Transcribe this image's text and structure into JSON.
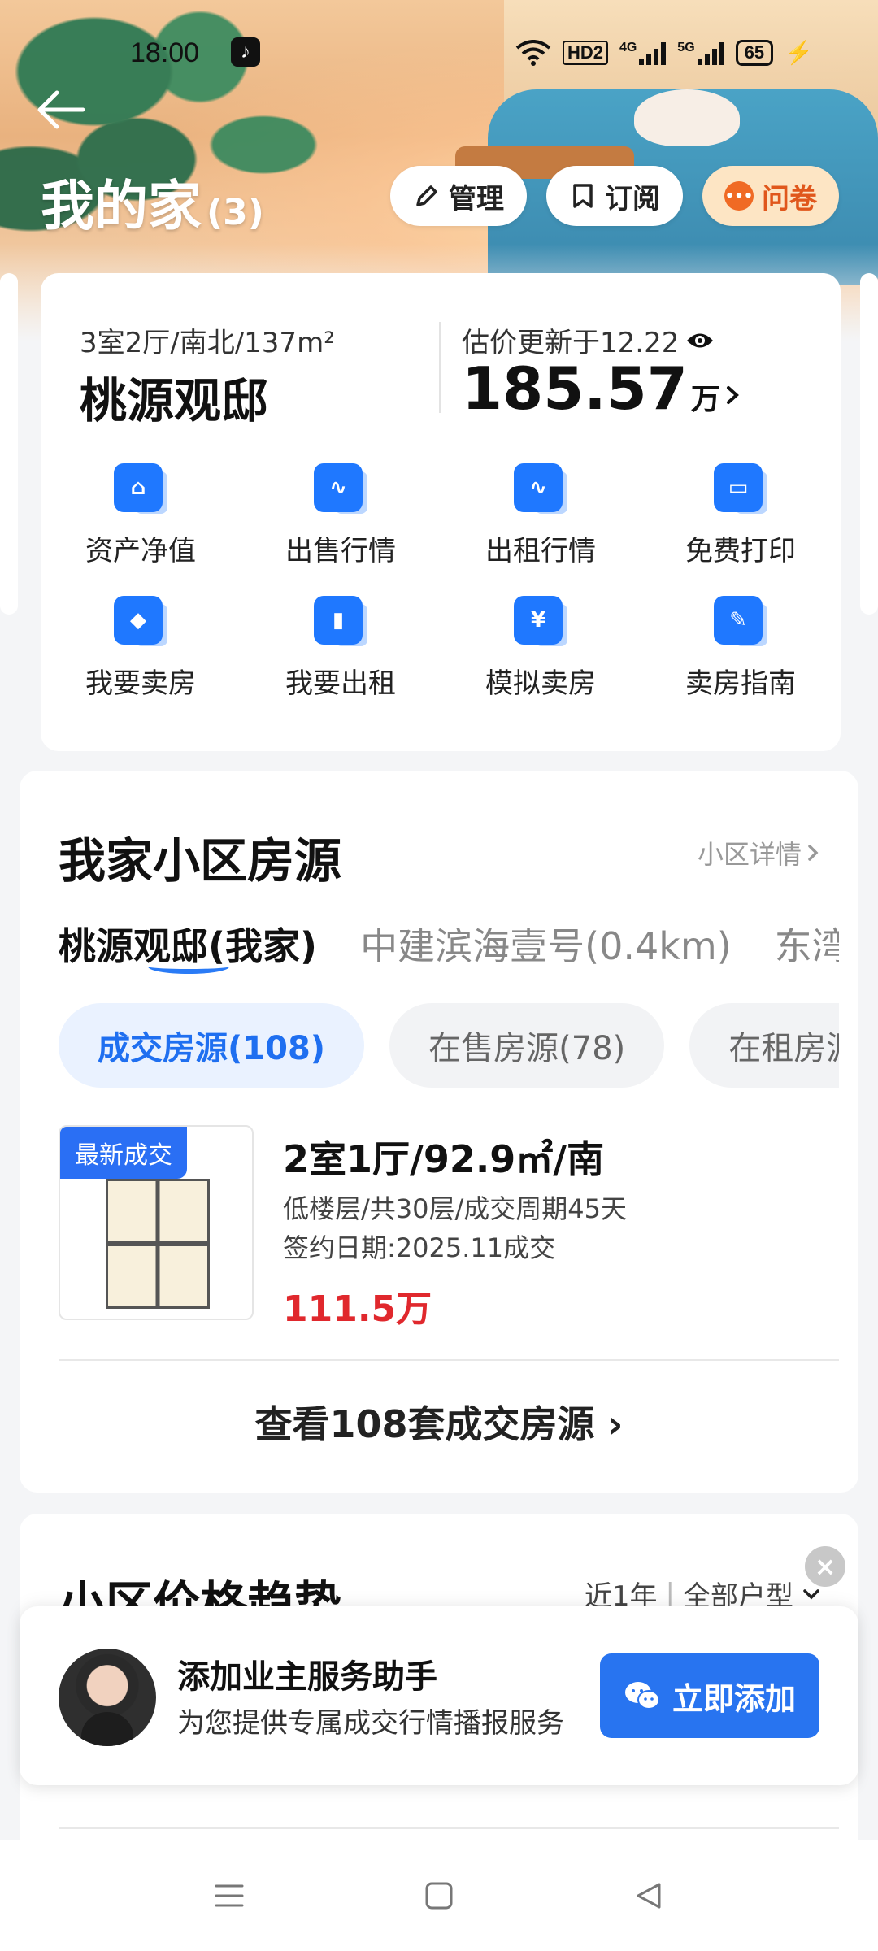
{
  "status_bar": {
    "time": "18:00",
    "network": "HD2",
    "signal1": "4G",
    "signal2": "5G",
    "battery": "65"
  },
  "header": {
    "title": "我的家",
    "count": "(3)",
    "manage_label": "管理",
    "subscribe_label": "订阅",
    "survey_label": "问卷"
  },
  "property": {
    "specs": "3室2厅/南北/137m²",
    "name": "桃源观邸",
    "price_label": "估价更新于12.22",
    "price_value": "185.57",
    "price_unit": "万"
  },
  "services": [
    {
      "label": "资产净值",
      "icon": "asset-chart-icon"
    },
    {
      "label": "出售行情",
      "icon": "sale-trend-icon"
    },
    {
      "label": "出租行情",
      "icon": "rent-trend-icon"
    },
    {
      "label": "免费打印",
      "icon": "printer-icon"
    },
    {
      "label": "我要卖房",
      "icon": "sell-tag-icon"
    },
    {
      "label": "我要出租",
      "icon": "suitcase-icon"
    },
    {
      "label": "模拟卖房",
      "icon": "yuan-house-icon"
    },
    {
      "label": "卖房指南",
      "icon": "guide-icon"
    }
  ],
  "community": {
    "title": "我家小区房源",
    "detail_link": "小区详情",
    "tabs": [
      "桃源观邸(我家)",
      "中建滨海壹号(0.4km)",
      "东湾"
    ],
    "chips": [
      "成交房源(108)",
      "在售房源(78)",
      "在租房源"
    ],
    "listing": {
      "badge": "最新成交",
      "title": "2室1厅/92.9㎡/南",
      "line1": "低楼层/共30层/成交周期45天",
      "line2": "签约日期:2025.11成交",
      "price": "111.5万"
    },
    "view_all": "查看108套成交房源"
  },
  "trend": {
    "title": "小区价格趋势",
    "filter_period": "近1年",
    "filter_type": "全部户型"
  },
  "assistant": {
    "title": "添加业主服务助手",
    "subtitle": "为您提供专属成交行情播报服务",
    "button_label": "立即添加"
  },
  "colors": {
    "accent": "#2874f0",
    "price_red": "#e0282d",
    "survey_orange": "#f06a24"
  }
}
